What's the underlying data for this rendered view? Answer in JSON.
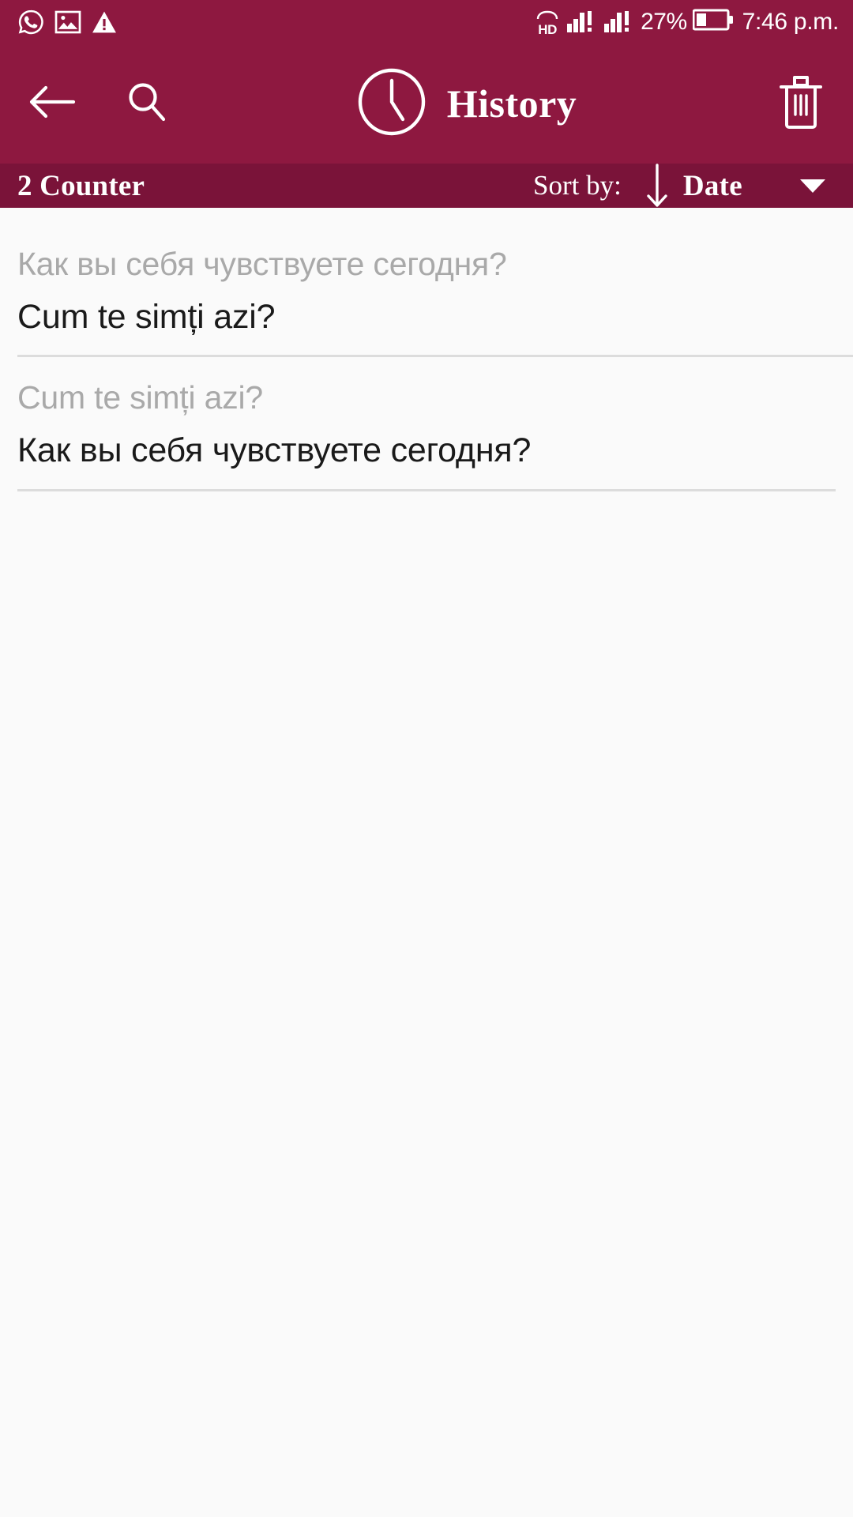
{
  "statusbar": {
    "left_icons": [
      "whatsapp-icon",
      "image-icon",
      "warning-icon"
    ],
    "volte_label": "HD",
    "signal_icons": [
      "signal-bars-sim1-icon",
      "signal-bars-sim2-icon"
    ],
    "battery_percent": "27%",
    "battery_icon": "battery-icon",
    "time": "7:46 p.m."
  },
  "toolbar": {
    "back_icon": "back-arrow-icon",
    "search_icon": "search-icon",
    "clock_icon": "clock-icon",
    "title": "History",
    "delete_icon": "trash-icon"
  },
  "sortbar": {
    "counter": "2 Counter",
    "sort_label": "Sort by:",
    "sort_direction_icon": "arrow-down-icon",
    "sort_value": "Date",
    "dropdown_icon": "caret-down-icon"
  },
  "history": {
    "items": [
      {
        "source_text": "Как вы себя чувствуете сегодня?",
        "target_text": "Cum te simți azi?"
      },
      {
        "source_text": "Cum te simți azi?",
        "target_text": "Как вы себя чувствуете сегодня?"
      }
    ]
  },
  "colors": {
    "primary": "#8E1840",
    "primary_dark": "#7A1339",
    "background": "#fafafa",
    "source_text": "#a9a9a9",
    "target_text": "#1a1a1a",
    "divider": "#dcdcdc"
  }
}
